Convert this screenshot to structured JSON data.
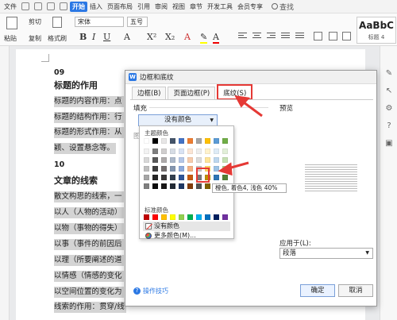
{
  "menubar": {
    "file": "文件",
    "active_tab": "开始",
    "tabs": [
      "插入",
      "页面布局",
      "引用",
      "审阅",
      "视图",
      "章节",
      "开发工具",
      "会员专享"
    ],
    "search": "查找"
  },
  "ribbon": {
    "paste": "粘贴",
    "cut": "剪切",
    "copy": "复制",
    "format_painter": "格式刷",
    "font_name": "宋体",
    "font_size": "五号",
    "style_preview": "AaBbC",
    "style_name": "标题 4"
  },
  "document": {
    "lines": [
      {
        "text": "09",
        "kind": "num"
      },
      {
        "text": "标题的作用",
        "kind": "head"
      },
      {
        "text": "标题的内容作用：点",
        "kind": "hl"
      },
      {
        "text": "标题的结构作用：行",
        "kind": "hl"
      },
      {
        "text": "标题的形式作用：从",
        "kind": "hl"
      },
      {
        "text": "颖、设置悬念等。",
        "kind": "hl"
      },
      {
        "text": "10",
        "kind": "num"
      },
      {
        "text": "文章的线索",
        "kind": "head"
      },
      {
        "text": "散文构思的线索，一",
        "kind": "hl"
      },
      {
        "text": "以人（人物的活动）",
        "kind": "hl"
      },
      {
        "text": "以物（事物的得失）",
        "kind": "hl"
      },
      {
        "text": "以事（事件的前因后",
        "kind": "hl"
      },
      {
        "text": "以理（所要阐述的道",
        "kind": "hl"
      },
      {
        "text": "以情感（情感的变化",
        "kind": "hl"
      },
      {
        "text": "以空间位置的变化为",
        "kind": "hl"
      },
      {
        "text": "线索的作用：贯穿/线",
        "kind": "hl"
      }
    ]
  },
  "dialog": {
    "title": "边框和底纹",
    "tabs": [
      "边框(B)",
      "页面边框(P)",
      "底纹(S)"
    ],
    "fill_label": "填充",
    "fill_value": "没有颜色",
    "pattern_label": "图",
    "preview_label": "预览",
    "apply_to_label": "应用于(L):",
    "apply_to_value": "段落",
    "tips": "操作技巧",
    "ok": "确定",
    "cancel": "取消"
  },
  "palette": {
    "theme_label": "主题颜色",
    "standard_label": "标准颜色",
    "no_color": "没有颜色",
    "more_colors": "更多颜色(M)...",
    "tooltip": "橙色, 着色4, 浅色 40%",
    "theme_top": [
      "#ffffff",
      "#000000",
      "#e7e6e6",
      "#44546a",
      "#4472c4",
      "#ed7d31",
      "#a5a5a5",
      "#ffc000",
      "#5b9bd5",
      "#70ad47"
    ],
    "theme_shades": [
      [
        "#f2f2f2",
        "#7f7f7f",
        "#d0cece",
        "#d6dce4",
        "#d9e2f3",
        "#fbe5d5",
        "#ededed",
        "#fff2cc",
        "#deebf6",
        "#e2efd9"
      ],
      [
        "#d8d8d8",
        "#595959",
        "#aeaaaa",
        "#adb9ca",
        "#b4c6e7",
        "#f7cbac",
        "#dbdbdb",
        "#fee599",
        "#bdd7ee",
        "#c5e0b3"
      ],
      [
        "#bfbfbf",
        "#3f3f3f",
        "#757070",
        "#8496b0",
        "#8eaadb",
        "#f4b183",
        "#c9c9c9",
        "#ffd965",
        "#9cc3e5",
        "#a8d08d"
      ],
      [
        "#a5a5a5",
        "#262626",
        "#3a3838",
        "#323f4f",
        "#2f5496",
        "#c55a11",
        "#7b7b7b",
        "#bf9000",
        "#2e75b5",
        "#538135"
      ],
      [
        "#7f7f7f",
        "#0c0c0c",
        "#171616",
        "#222a35",
        "#1f3864",
        "#833c0b",
        "#525252",
        "#7f6000",
        "#1e4e79",
        "#375623"
      ]
    ],
    "standard": [
      "#c00000",
      "#ff0000",
      "#ffc000",
      "#ffff00",
      "#92d050",
      "#00b050",
      "#00b0f0",
      "#0070c0",
      "#002060",
      "#7030a0"
    ]
  }
}
